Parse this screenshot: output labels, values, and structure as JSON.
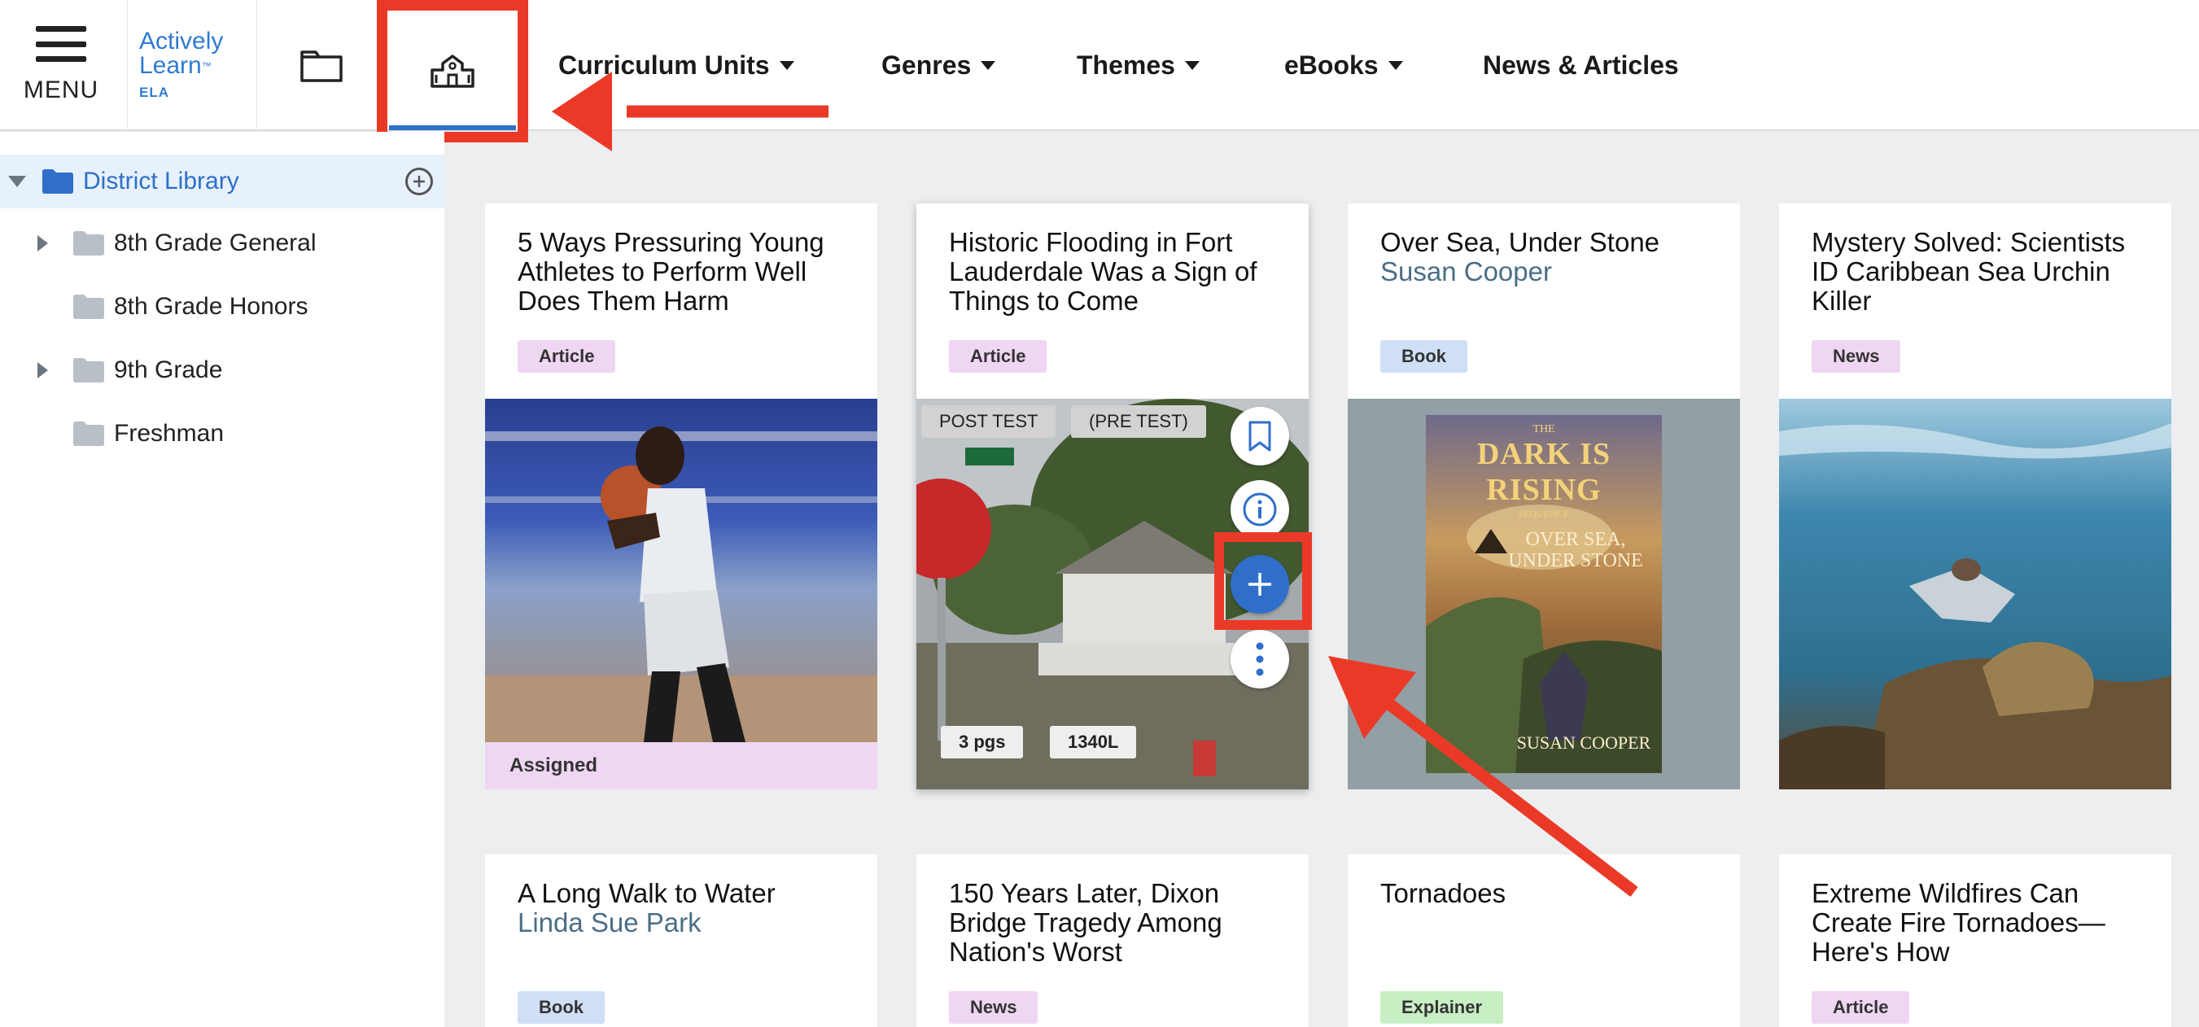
{
  "header": {
    "menu_label": "MENU",
    "logo": {
      "line1": "Actively",
      "line2": "Learn",
      "trademark": "™",
      "subject": "ELA"
    },
    "nav": [
      {
        "label": "Curriculum Units",
        "dropdown": true
      },
      {
        "label": "Genres",
        "dropdown": true
      },
      {
        "label": "Themes",
        "dropdown": true
      },
      {
        "label": "eBooks",
        "dropdown": true
      },
      {
        "label": "News & Articles",
        "dropdown": false
      }
    ]
  },
  "sidebar": {
    "root": {
      "label": "District Library",
      "expanded": true
    },
    "items": [
      {
        "label": "8th Grade General",
        "expandable": true
      },
      {
        "label": "8th Grade Honors",
        "expandable": false
      },
      {
        "label": "9th Grade",
        "expandable": true
      },
      {
        "label": "Freshman",
        "expandable": false
      }
    ]
  },
  "cards": [
    {
      "title": "5 Ways Pressuring Young Athletes to Perform Well Does Them Harm",
      "tag": "Article",
      "image": "basketball-player",
      "status": "Assigned"
    },
    {
      "title": "Historic Flooding in Fort Lauderdale Was a Sign of Things to Come",
      "tag": "Article",
      "image": "flooded-street",
      "chips_top": [
        "POST TEST",
        "(PRE TEST)"
      ],
      "chips_bottom": [
        "3 pgs",
        "1340L"
      ]
    },
    {
      "title": "Over Sea, Under Stone",
      "author": "Susan Cooper",
      "tag": "Book",
      "image": "book-cover",
      "cover": {
        "series_small": "THE",
        "series_main": "DARK IS RISING",
        "series_sub": "SEQUENCE",
        "title_line1": "OVER SEA,",
        "title_line2": "UNDER STONE",
        "author": "SUSAN COOPER"
      }
    },
    {
      "title": "Mystery Solved: Scientists ID Caribbean Sea Urchin Killer",
      "tag": "News",
      "image": "underwater-diver"
    },
    {
      "title": "A Long Walk to Water",
      "author": "Linda Sue Park",
      "tag": "Book"
    },
    {
      "title": "150 Years Later, Dixon Bridge Tragedy Among Nation's Worst",
      "tag": "News"
    },
    {
      "title": "Tornadoes",
      "tag": "Explainer"
    },
    {
      "title": "Extreme Wildfires Can Create Fire Tornadoes—Here's How",
      "tag": "Article"
    }
  ],
  "colors": {
    "brand": "#2f7bd3",
    "annotation": "#ea3a27",
    "active_nav": "#2f6fc9"
  }
}
